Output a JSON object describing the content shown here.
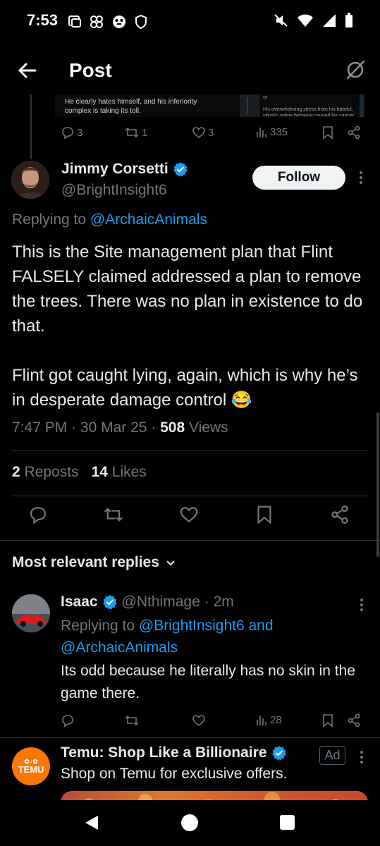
{
  "status_bar": {
    "time": "7:53"
  },
  "header": {
    "title": "Post"
  },
  "previous_reply": {
    "left_text": "He clearly hates himself, and his inferiority complex is taking its toll.",
    "right_top": "or",
    "right_text": "His overwhelming stress from his hateful, vitriolic online behavior caused his cancer",
    "replies": "3",
    "reposts": "1",
    "likes": "3",
    "views": "335"
  },
  "post": {
    "author_name": "Jimmy Corsetti",
    "author_handle": "@BrightInsight6",
    "follow_label": "Follow",
    "replying_prefix": "Replying to",
    "replying_to": "@ArchaicAnimals",
    "body_p1": "This is the Site management plan that Flint FALSELY claimed addressed a plan to remove the trees. There was no plan in existence to do that.",
    "body_p2": "Flint got caught lying, again, which is why he’s in desperate damage control 😂",
    "time": "7:47 PM",
    "date": "30 Mar 25",
    "views_count": "508",
    "views_label": "Views",
    "reposts_count": "2",
    "reposts_label": "Reposts",
    "likes_count": "14",
    "likes_label": "Likes"
  },
  "replies_header": "Most relevant replies",
  "reply": {
    "name": "Isaac",
    "handle": "@Nthimage",
    "time": "· 2m",
    "replying_prefix": "Replying to",
    "replying_to_1": "@BrightInsight6",
    "replying_and": "and",
    "replying_to_2": "@ArchaicAnimals",
    "body": "Its odd because he literally has no skin in the game there.",
    "views": "28"
  },
  "ad": {
    "avatar_text": "TEMU",
    "name": "Temu: Shop Like a Billionaire",
    "badge": "Ad",
    "text": "Shop on Temu for exclusive offers."
  },
  "colors": {
    "accent": "#1d9bf0",
    "background": "#000000",
    "muted": "#71767b",
    "temu": "#fb7701"
  }
}
